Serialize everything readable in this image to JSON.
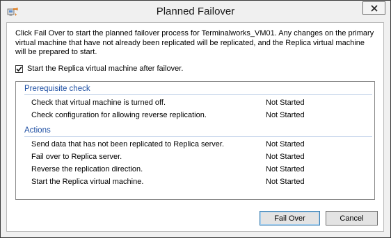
{
  "window": {
    "title": "Planned Failover",
    "icon": "hyperv-replica-icon",
    "close_icon": "close-icon"
  },
  "description": "Click Fail Over to start the planned failover process for Terminalworks_VM01. Any changes on the primary virtual machine that have not already been replicated will be replicated, and the Replica virtual machine will be prepared to start.",
  "start_after_failover": {
    "label": "Start the Replica virtual machine after failover.",
    "checked": true
  },
  "sections": [
    {
      "title": "Prerequisite check",
      "steps": [
        {
          "label": "Check that virtual machine is turned off.",
          "status": "Not Started"
        },
        {
          "label": "Check configuration for allowing reverse replication.",
          "status": "Not Started"
        }
      ]
    },
    {
      "title": "Actions",
      "steps": [
        {
          "label": "Send data that has not been replicated to Replica server.",
          "status": "Not Started"
        },
        {
          "label": "Fail over to Replica server.",
          "status": "Not Started"
        },
        {
          "label": "Reverse the replication direction.",
          "status": "Not Started"
        },
        {
          "label": "Start the Replica virtual machine.",
          "status": "Not Started"
        }
      ]
    }
  ],
  "buttons": {
    "fail_over": "Fail Over",
    "cancel": "Cancel"
  },
  "colors": {
    "section_title": "#1e4fa3",
    "section_line": "#c4d3ea"
  }
}
